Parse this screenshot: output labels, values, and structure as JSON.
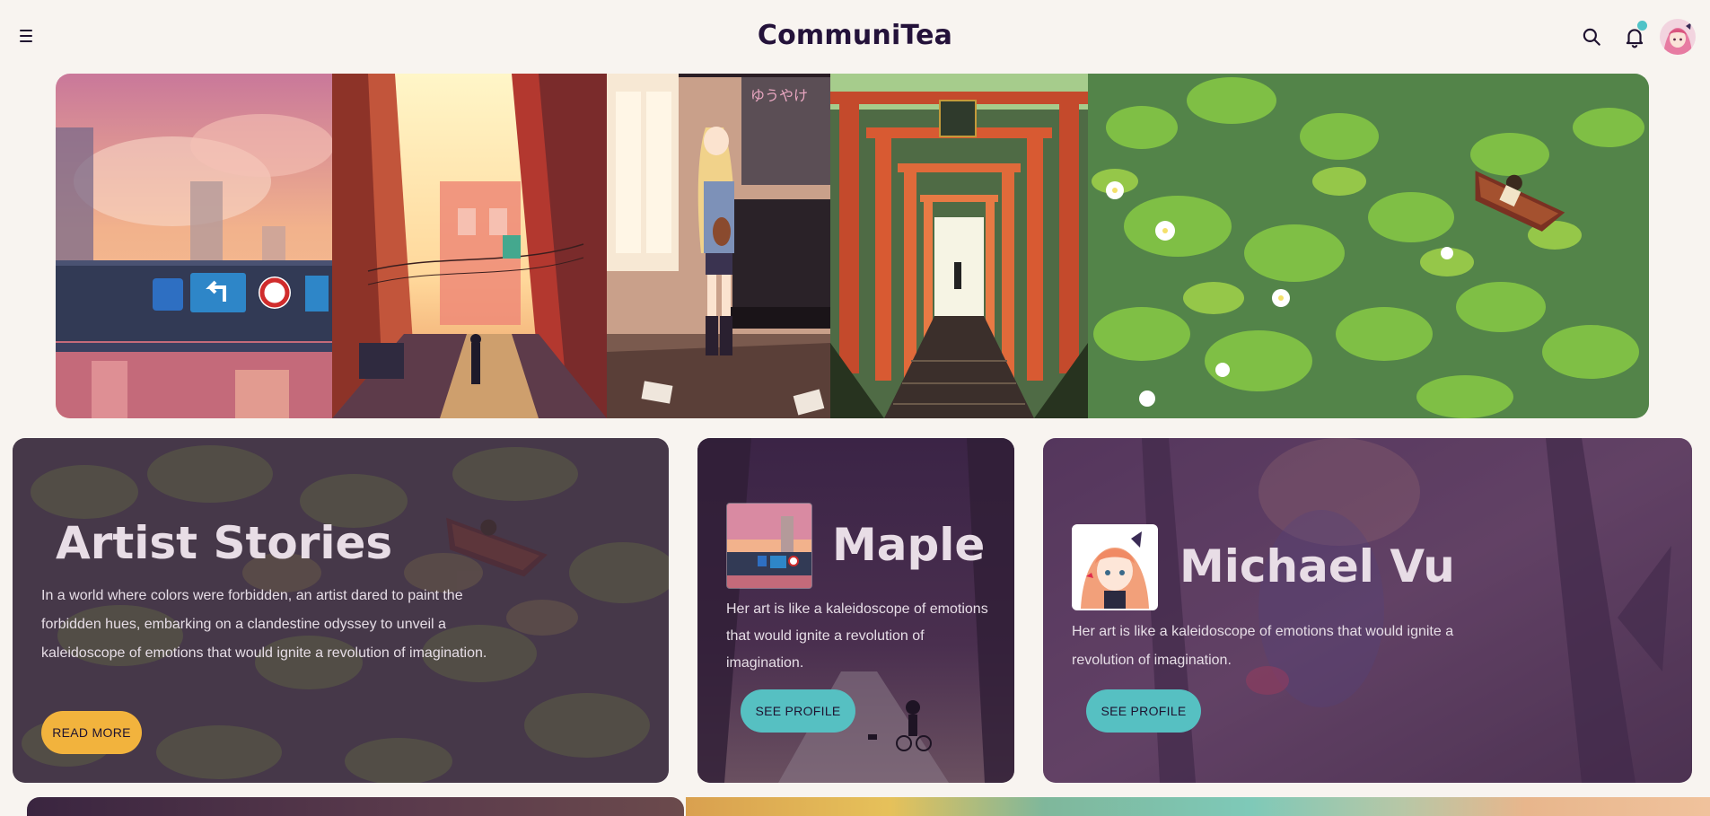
{
  "header": {
    "brand": "CommuniTea",
    "icons": [
      "menu-icon",
      "search-icon",
      "bell-icon",
      "avatar"
    ],
    "notification_dot_color": "#4fc3c7"
  },
  "banner": {
    "panels": [
      "city-bridge-sunset",
      "alley-sunlight",
      "music-room-girl",
      "torii-gate-stairs",
      "lily-pond-boat"
    ]
  },
  "stories_card": {
    "title": "Artist Stories",
    "text": "In a world where colors were forbidden, an artist dared to paint the forbidden hues, embarking on a clandestine odyssey to unveil a kaleidoscope of emotions that would ignite a revolution of imagination.",
    "button": "READ MORE"
  },
  "artist_cards": [
    {
      "name": "Maple",
      "text": "Her art is like a kaleidoscope of emotions that would ignite a revolution of imagination.",
      "button": "SEE PROFILE"
    },
    {
      "name": "Michael Vu",
      "text": "Her art is like a kaleidoscope of emotions that would ignite a revolution of imagination.",
      "button": "SEE PROFILE"
    }
  ],
  "colors": {
    "background": "#f8f4f0",
    "brand_text": "#24123a",
    "gold_button": "#f2b33d",
    "teal_button": "#56c0c2"
  }
}
